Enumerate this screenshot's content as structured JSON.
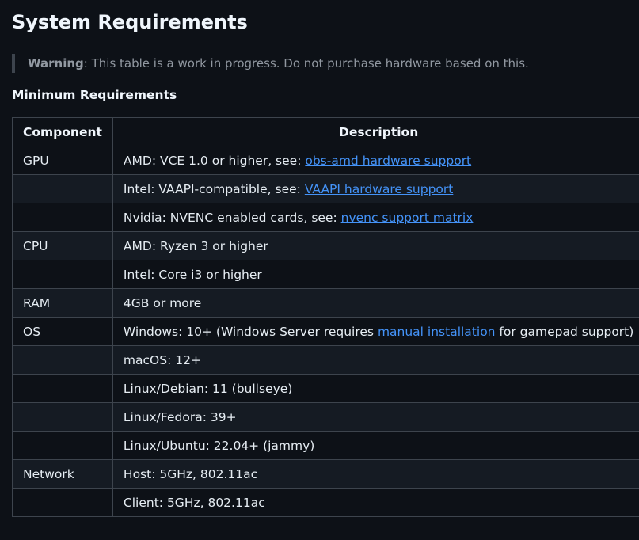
{
  "title": "System Requirements",
  "warning": {
    "label": "Warning",
    "text": ": This table is a work in progress. Do not purchase hardware based on this."
  },
  "subheading": "Minimum Requirements",
  "table": {
    "headers": [
      "Component",
      "Description"
    ],
    "rows": [
      {
        "component": "GPU",
        "pre": "AMD: VCE 1.0 or higher, see: ",
        "link": "obs-amd hardware support",
        "post": ""
      },
      {
        "component": "",
        "pre": "Intel: VAAPI-compatible, see: ",
        "link": "VAAPI hardware support",
        "post": ""
      },
      {
        "component": "",
        "pre": "Nvidia: NVENC enabled cards, see: ",
        "link": "nvenc support matrix",
        "post": ""
      },
      {
        "component": "CPU",
        "pre": "AMD: Ryzen 3 or higher",
        "link": "",
        "post": ""
      },
      {
        "component": "",
        "pre": "Intel: Core i3 or higher",
        "link": "",
        "post": ""
      },
      {
        "component": "RAM",
        "pre": "4GB or more",
        "link": "",
        "post": ""
      },
      {
        "component": "OS",
        "pre": "Windows: 10+ (Windows Server requires ",
        "link": "manual installation",
        "post": " for gamepad support)"
      },
      {
        "component": "",
        "pre": "macOS: 12+",
        "link": "",
        "post": ""
      },
      {
        "component": "",
        "pre": "Linux/Debian: 11 (bullseye)",
        "link": "",
        "post": ""
      },
      {
        "component": "",
        "pre": "Linux/Fedora: 39+",
        "link": "",
        "post": ""
      },
      {
        "component": "",
        "pre": "Linux/Ubuntu: 22.04+ (jammy)",
        "link": "",
        "post": ""
      },
      {
        "component": "Network",
        "pre": "Host: 5GHz, 802.11ac",
        "link": "",
        "post": ""
      },
      {
        "component": "",
        "pre": "Client: 5GHz, 802.11ac",
        "link": "",
        "post": ""
      }
    ]
  },
  "colors": {
    "background": "#0d1117",
    "text": "#e6edf3",
    "muted": "#9198a1",
    "link": "#4493f8",
    "border": "#3d444d",
    "stripe": "#151b23"
  }
}
